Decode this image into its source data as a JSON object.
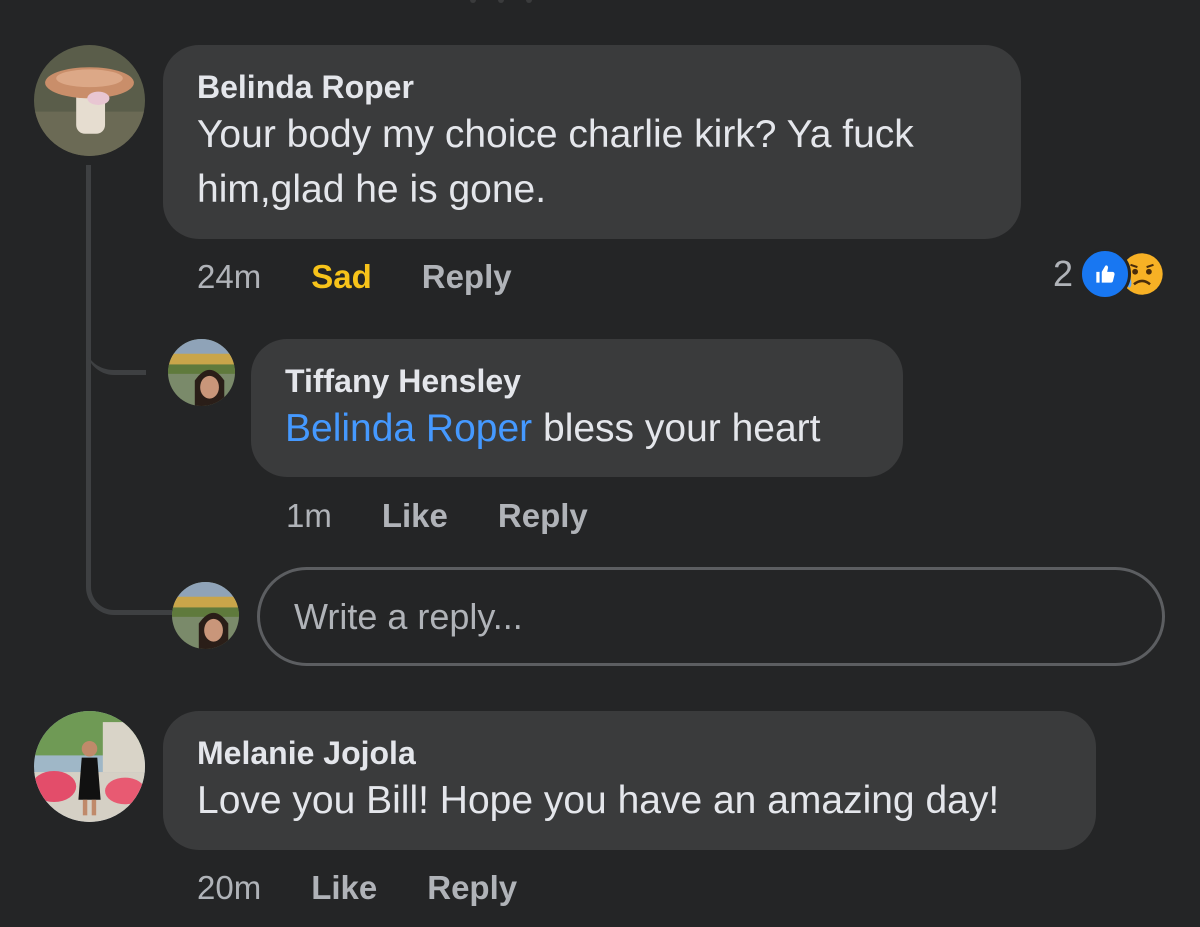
{
  "comments": [
    {
      "author": "Belinda Roper",
      "text": "Your body my choice charlie kirk? Ya fuck him,glad he is gone.",
      "time": "24m",
      "reaction_label": "Sad",
      "reply_label": "Reply",
      "reaction_count": "2",
      "reaction_icons": [
        "like-icon",
        "sad-face-icon"
      ]
    },
    {
      "author": "Tiffany Hensley",
      "mention": "Belinda Roper",
      "text": "bless your heart",
      "time": "1m",
      "like_label": "Like",
      "reply_label": "Reply"
    },
    {
      "author": "Melanie Jojola",
      "text": "Love you Bill! Hope you have an amazing day!",
      "time": "20m",
      "like_label": "Like",
      "reply_label": "Reply"
    }
  ],
  "reply_box": {
    "placeholder": "Write a reply..."
  },
  "colors": {
    "background": "#242526",
    "bubble": "#3a3b3c",
    "text": "#e4e6eb",
    "secondary_text": "#b0b3b8",
    "mention": "#4599ff",
    "sad_reaction": "#f7c31a",
    "like_blue": "#1877f2"
  }
}
